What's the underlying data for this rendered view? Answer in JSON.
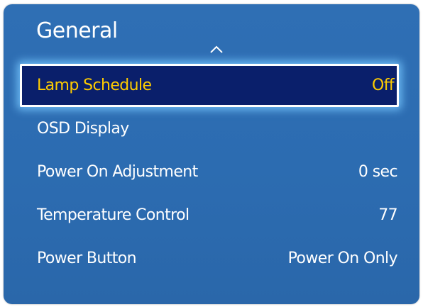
{
  "panel": {
    "title": "General",
    "scroll_up_icon": "chevron-up-icon"
  },
  "menu": {
    "items": [
      {
        "label": "Lamp Schedule",
        "value": "Off",
        "selected": true
      },
      {
        "label": "OSD Display",
        "value": ""
      },
      {
        "label": "Power On Adjustment",
        "value": "0 sec"
      },
      {
        "label": "Temperature Control",
        "value": "77"
      },
      {
        "label": "Power Button",
        "value": "Power On Only"
      }
    ]
  },
  "colors": {
    "panel_background": "#2c6cb1",
    "selected_background": "#0a1f6b",
    "selected_text": "#ffcc00",
    "selected_glow": "#78c8ff",
    "text": "#ffffff"
  }
}
